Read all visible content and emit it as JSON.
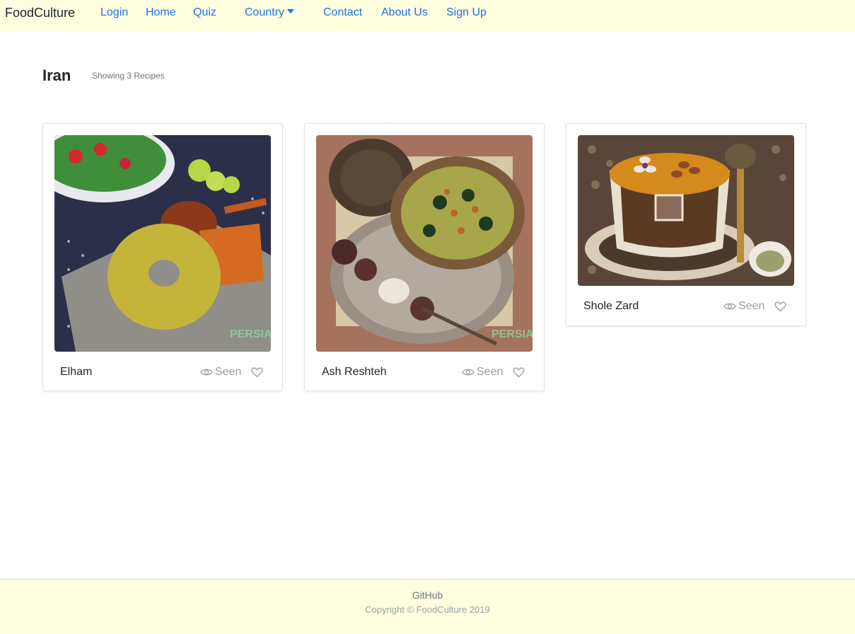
{
  "nav": {
    "brand": "FoodCulture",
    "login": "Login",
    "home": "Home",
    "quiz": "Quiz",
    "country": "Country",
    "contact": "Contact",
    "about": "About Us",
    "signup": "Sign Up"
  },
  "page": {
    "title": "Iran",
    "count": "Showing 3 Recipes"
  },
  "recipes": [
    {
      "name": "Elham",
      "seen_label": "Seen"
    },
    {
      "name": "Ash Reshteh",
      "seen_label": "Seen"
    },
    {
      "name": "Shole Zard",
      "seen_label": "Seen"
    }
  ],
  "footer": {
    "link": "GitHub",
    "copyright": "Copyright © FoodCulture 2019"
  },
  "colors": {
    "nav_bg": "#ffffe0",
    "link": "#1a73e8",
    "muted": "#9aa0a6"
  },
  "icons": [
    "eye-icon",
    "heart-icon",
    "caret-down-icon"
  ]
}
